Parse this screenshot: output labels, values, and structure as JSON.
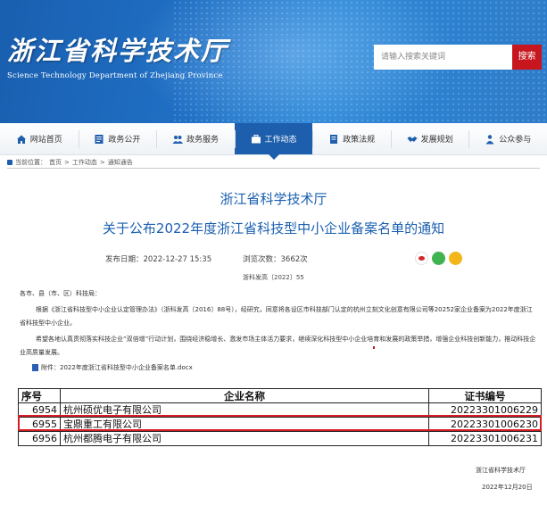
{
  "header": {
    "title": "浙江省科学技术厅",
    "subtitle": "Science Technology Department of Zhejiang Province",
    "search_placeholder": "请输入搜索关键词",
    "search_button": "搜索"
  },
  "nav": {
    "items": [
      {
        "label": "网站首页",
        "icon": "home-icon"
      },
      {
        "label": "政务公开",
        "icon": "list-icon"
      },
      {
        "label": "政务服务",
        "icon": "group-icon"
      },
      {
        "label": "工作动态",
        "icon": "briefcase-icon",
        "active": true
      },
      {
        "label": "政策法规",
        "icon": "document-icon"
      },
      {
        "label": "发展规划",
        "icon": "handshake-icon"
      },
      {
        "label": "公众参与",
        "icon": "users-icon"
      }
    ]
  },
  "breadcrumb": {
    "prefix": "当前位置：",
    "items": [
      "首页",
      "工作动态",
      "通知通告"
    ],
    "separator": ">"
  },
  "article": {
    "org": "浙江省科学技术厅",
    "title": "关于公布2022年度浙江省科技型中小企业备案名单的通知",
    "date": "发布日期：2022-12-27 15:35",
    "views": "浏览次数：3662次",
    "doc_no": "浙科发高〔2022〕55",
    "paragraphs": [
      "各市、县（市、区）科技局：",
      "根据《浙江省科技型中小企业认定管理办法》（浙科发高〔2016〕88号），经研究，同意将各设区市科技部门认定的杭州立刻文化创意有限公司等20252家企业备案为2022年度浙江省科技型中小企业。",
      "希望各地认真贯彻落实科技企业“双倍增”行动计划，围绕经济稳增长、激发市场主体活力要求，继续深化科技型中小企业培育和发展的政策举措，增强企业科技创新能力，推动科技企业高质量发展。"
    ],
    "attachment": "附件：2022年度浙江省科技型中小企业备案名单.docx"
  },
  "table": {
    "headers": [
      "序号",
      "企业名称",
      "证书编号"
    ],
    "rows": [
      {
        "no": "6954",
        "name": "杭州硕优电子有限公司",
        "cert": "20223301006229"
      },
      {
        "no": "6955",
        "name": "宝鼎重工有限公司",
        "cert": "20223301006230",
        "highlighted": true
      },
      {
        "no": "6956",
        "name": "杭州都腾电子有限公司",
        "cert": "20223301006231"
      }
    ],
    "highlight_color": "#d71d24"
  },
  "signature": {
    "org": "浙江省科学技术厅",
    "date": "2022年12月20日"
  },
  "colors": {
    "brand_blue": "#1d5fad",
    "title_blue": "#1a5fb0",
    "search_red": "#c7161e"
  }
}
